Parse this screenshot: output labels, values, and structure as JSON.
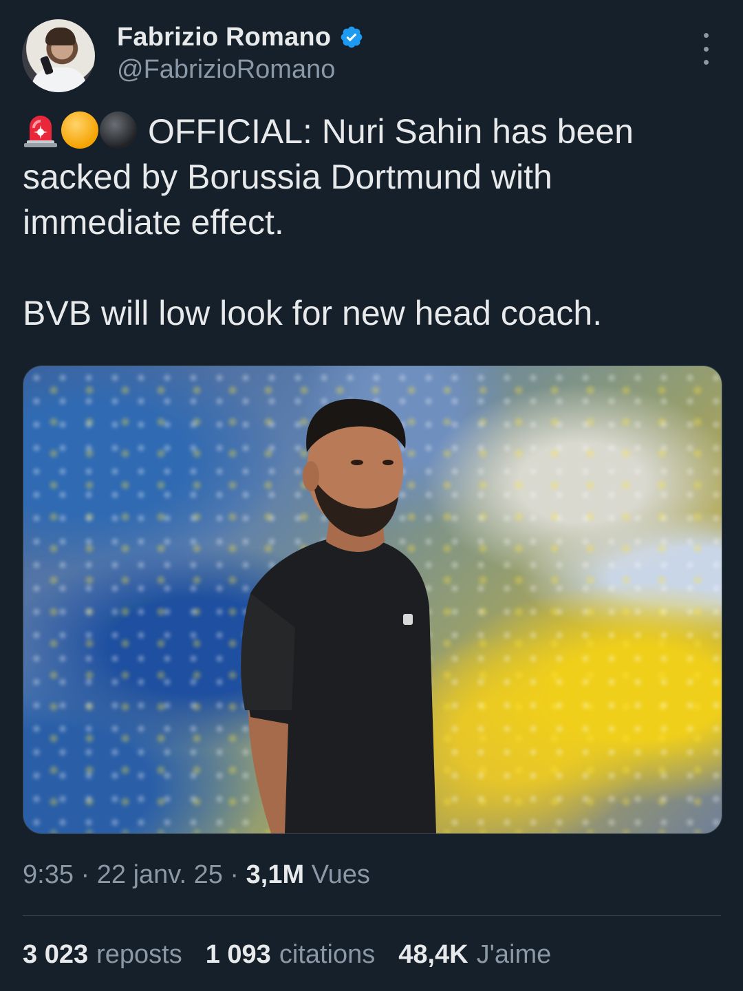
{
  "author": {
    "display_name": "Fabrizio Romano",
    "handle": "@FabrizioRomano",
    "verified": true
  },
  "icons": {
    "verified": "verified-badge-icon",
    "more": "more-options-icon",
    "emojis": [
      "rotating-light-icon",
      "yellow-circle-icon",
      "black-circle-icon"
    ]
  },
  "tweet": {
    "line1": "OFFICIAL: Nuri Sahin has been sacked by Borussia Dortmund with immediate effect.",
    "line2": "BVB will low look for new head coach."
  },
  "meta": {
    "time": "9:35",
    "date": "22 janv. 25",
    "views_count": "3,1M",
    "views_label": "Vues",
    "separator": "·"
  },
  "stats": {
    "reposts_count": "3 023",
    "reposts_label": "reposts",
    "quotes_count": "1 093",
    "quotes_label": "citations",
    "likes_count": "48,4K",
    "likes_label": "J'aime"
  },
  "colors": {
    "background": "#15202b",
    "text": "#e7e9ea",
    "secondary_text": "#8b98a5",
    "verified_blue": "#1d9bf0",
    "divider": "#38444d"
  }
}
